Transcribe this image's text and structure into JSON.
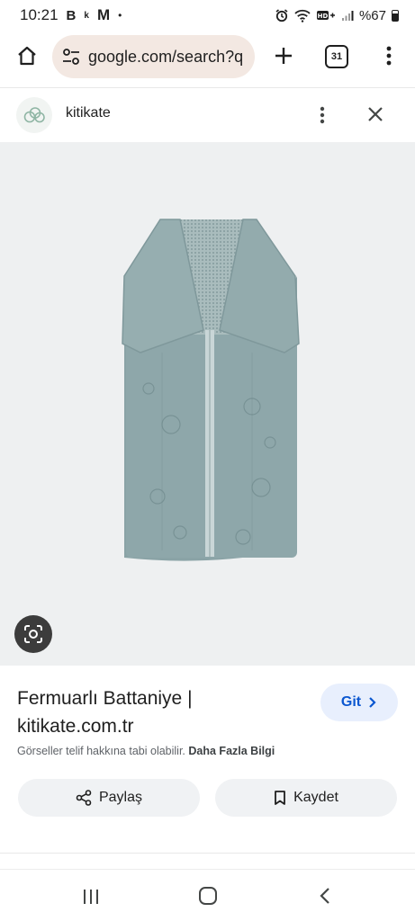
{
  "status_bar": {
    "time": "10:21",
    "icons_left": [
      "B",
      "k",
      "M",
      "•"
    ],
    "battery_text": "%67",
    "icons_right": [
      "alarm-icon",
      "wifi-icon",
      "hd-volte-icon",
      "signal-icon",
      "battery-icon"
    ]
  },
  "browser": {
    "url": "google.com/search?q",
    "tab_count": "31",
    "icons": [
      "home-icon",
      "tune-icon",
      "plus-icon",
      "more-vert-icon"
    ]
  },
  "source": {
    "site_name": "kitikate",
    "icons": [
      "cloud-logo-icon",
      "more-vert-icon",
      "close-icon"
    ]
  },
  "result": {
    "title": "Fermuarlı Battaniye | kitikate.com.tr",
    "visit_label": "Git",
    "copyright_text": "Görseller telif hakkına tabi olabilir.",
    "more_info_label": "Daha Fazla Bilgi",
    "share_label": "Paylaş",
    "save_label": "Kaydet",
    "icons": [
      "lens-icon",
      "chevron-right-icon",
      "share-icon",
      "bookmark-icon"
    ]
  },
  "colors": {
    "omnibox_bg": "#f3e8e2",
    "image_bg": "#eef0f1",
    "visit_bg": "#e8effd",
    "visit_text": "#0b57d0",
    "pill_bg": "#f0f2f4",
    "product": "#8aa3a6"
  },
  "nav": {
    "icons": [
      "recents-icon",
      "home-icon",
      "back-icon"
    ]
  }
}
